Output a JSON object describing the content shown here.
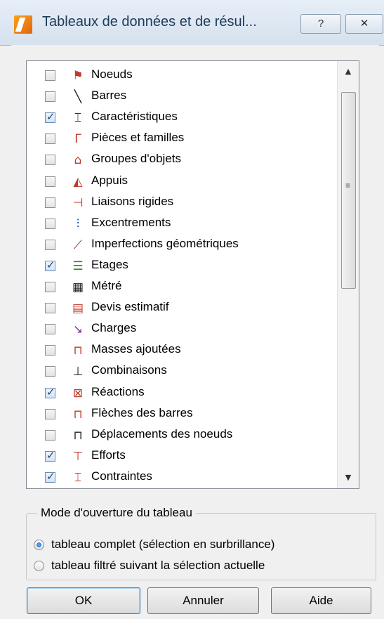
{
  "window": {
    "title": "Tableaux de données et de résul...",
    "help_button": "?",
    "close_button": "✕"
  },
  "items": [
    {
      "label": "Noeuds",
      "checked": false,
      "icon": "node-icon",
      "glyph": "⚑",
      "color": "#c0392b"
    },
    {
      "label": "Barres",
      "checked": false,
      "icon": "bar-icon",
      "glyph": "╲",
      "color": "#111111"
    },
    {
      "label": "Caractéristiques",
      "checked": true,
      "icon": "section-icon",
      "glyph": "⌶",
      "color": "#333333"
    },
    {
      "label": "Pièces et familles",
      "checked": false,
      "icon": "pieces-icon",
      "glyph": "Γ",
      "color": "#c0392b"
    },
    {
      "label": "Groupes d'objets",
      "checked": false,
      "icon": "groups-icon",
      "glyph": "⌂",
      "color": "#c0392b"
    },
    {
      "label": "Appuis",
      "checked": false,
      "icon": "support-icon",
      "glyph": "◭",
      "color": "#c0392b"
    },
    {
      "label": "Liaisons rigides",
      "checked": false,
      "icon": "rigid-link-icon",
      "glyph": "⊣",
      "color": "#c0392b"
    },
    {
      "label": "Excentrements",
      "checked": false,
      "icon": "eccentric-icon",
      "glyph": "⫶",
      "color": "#1f4fbf"
    },
    {
      "label": "Imperfections géométriques",
      "checked": false,
      "icon": "imperfection-icon",
      "glyph": "⟋",
      "color": "#8b1a1a"
    },
    {
      "label": "Etages",
      "checked": true,
      "icon": "floors-icon",
      "glyph": "☰",
      "color": "#2a8a2a"
    },
    {
      "label": "Métré",
      "checked": false,
      "icon": "metre-icon",
      "glyph": "▦",
      "color": "#222222"
    },
    {
      "label": "Devis estimatif",
      "checked": false,
      "icon": "estimate-icon",
      "glyph": "▤",
      "color": "#c0392b"
    },
    {
      "label": "Charges",
      "checked": false,
      "icon": "loads-icon",
      "glyph": "↘",
      "color": "#7a2ca8"
    },
    {
      "label": "Masses ajoutées",
      "checked": false,
      "icon": "mass-icon",
      "glyph": "⊓",
      "color": "#c0392b"
    },
    {
      "label": "Combinaisons",
      "checked": false,
      "icon": "combination-icon",
      "glyph": "⊥",
      "color": "#222222"
    },
    {
      "label": "Réactions",
      "checked": true,
      "icon": "reaction-icon",
      "glyph": "⊠",
      "color": "#c0392b"
    },
    {
      "label": "Flèches des barres",
      "checked": false,
      "icon": "deflection-icon",
      "glyph": "⊓",
      "color": "#c0392b"
    },
    {
      "label": "Déplacements des noeuds",
      "checked": false,
      "icon": "displacement-icon",
      "glyph": "⊓",
      "color": "#222222"
    },
    {
      "label": "Efforts",
      "checked": true,
      "icon": "forces-icon",
      "glyph": "⊤",
      "color": "#c0392b"
    },
    {
      "label": "Contraintes",
      "checked": true,
      "icon": "stress-icon",
      "glyph": "⌶",
      "color": "#c0392b"
    }
  ],
  "mode": {
    "title": "Mode d'ouverture du tableau",
    "options": [
      {
        "label": "tableau complet (sélection en surbrillance)",
        "selected": true
      },
      {
        "label": "tableau filtré suivant la sélection actuelle",
        "selected": false
      }
    ]
  },
  "buttons": {
    "ok": "OK",
    "cancel": "Annuler",
    "help": "Aide"
  }
}
